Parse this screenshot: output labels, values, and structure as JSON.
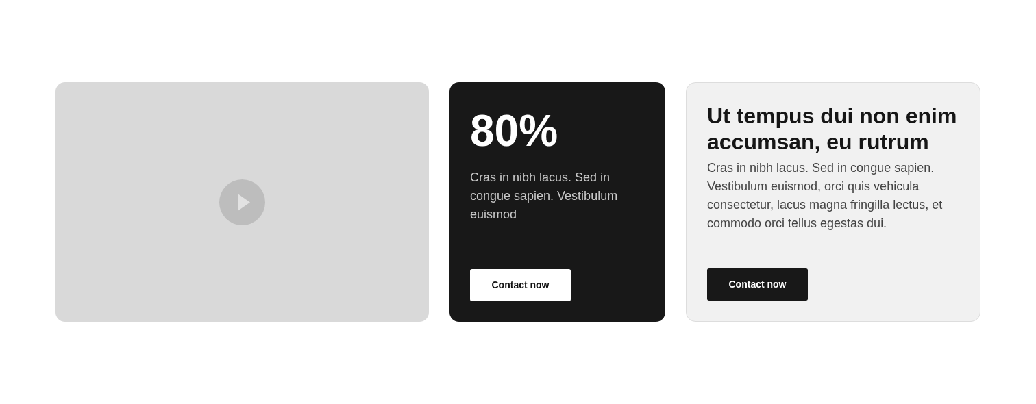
{
  "cards": [
    {
      "kind": "stat",
      "heading": "80%",
      "body": "Cras in nibh lacus. Sed in congue sapien. Vestibulum euismod",
      "button": "Contact now"
    },
    {
      "kind": "text",
      "heading": "Ut tempus dui non enim accumsan, eu rutrum",
      "body": "Cras in nibh lacus. Sed in congue sapien. Vestibulum euismod, orci quis vehicula consectetur, lacus magna fringilla lectus, et commodo orci tellus egestas dui.",
      "button": "Contact now"
    }
  ]
}
